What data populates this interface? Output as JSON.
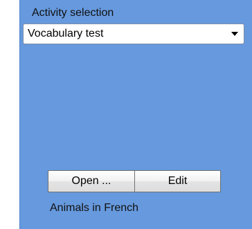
{
  "activity_selection": {
    "label": "Activity selection",
    "selected_value": "Vocabulary test"
  },
  "buttons": {
    "open_label": "Open ...",
    "edit_label": "Edit"
  },
  "current_activity": {
    "name": "Animals in French"
  },
  "icons": {
    "dropdown_arrow": "chevron-down-icon"
  },
  "colors": {
    "panel_background": "#6699dd",
    "dropdown_background": "#ffffff"
  }
}
